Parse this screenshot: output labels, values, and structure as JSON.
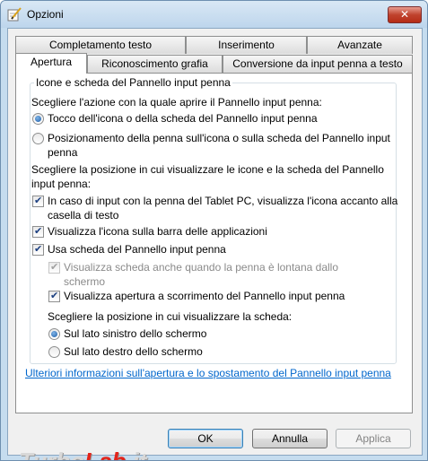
{
  "window": {
    "title": "Opzioni",
    "close_glyph": "✕"
  },
  "tabs_row1": [
    {
      "label": "Completamento testo"
    },
    {
      "label": "Inserimento"
    },
    {
      "label": "Avanzate"
    }
  ],
  "tabs_row2": [
    {
      "label": "Apertura",
      "active": true
    },
    {
      "label": "Riconoscimento grafia"
    },
    {
      "label": "Conversione da input penna a testo"
    }
  ],
  "group": {
    "title": "Icone e scheda del Pannello input penna",
    "open_action_label": "Scegliere l'azione con la quale aprire il Pannello input penna:",
    "radio1": {
      "line1": "Tocco dell'icona o della scheda del Pannello input penna",
      "checked": true
    },
    "radio2": {
      "line1": "Posizionamento della penna sull'icona o sulla scheda del Pannello input",
      "line2": "penna",
      "checked": false
    },
    "position_label_1": "Scegliere la posizione in cui visualizzare le icone e la scheda del Pannello",
    "position_label_2": "input penna:",
    "check1": {
      "line1": "In caso di input con la penna del Tablet PC, visualizza l'icona accanto alla",
      "line2": "casella di testo",
      "checked": true
    },
    "check2": {
      "line1": "Visualizza l'icona sulla barra delle applicazioni",
      "checked": true
    },
    "check3": {
      "line1": "Usa scheda del Pannello input penna",
      "checked": true
    },
    "check4": {
      "line1": "Visualizza scheda anche quando la penna è lontana dallo",
      "line2": "schermo",
      "checked": true,
      "disabled": true
    },
    "check5": {
      "line1": "Visualizza apertura a scorrimento del Pannello input penna",
      "checked": true
    },
    "side_label": "Scegliere la posizione in cui visualizzare la scheda:",
    "radio3": {
      "line1": "Sul lato sinistro dello schermo",
      "checked": true
    },
    "radio4": {
      "line1": "Sul lato destro dello schermo",
      "checked": false
    }
  },
  "link": "Ulteriori informazioni sull'apertura e lo spostamento del Pannello input penna",
  "buttons": {
    "ok": "OK",
    "cancel": "Annulla",
    "apply": "Applica"
  },
  "watermark": {
    "part1": "Turbo",
    "part2": "Lab",
    "part3": ".it"
  },
  "colors": {
    "link": "#0066cc",
    "window_frame": "#c5dcef",
    "close_button": "#c0432e"
  },
  "icons": {
    "app": "pen-notepad-icon",
    "close": "close-icon"
  }
}
